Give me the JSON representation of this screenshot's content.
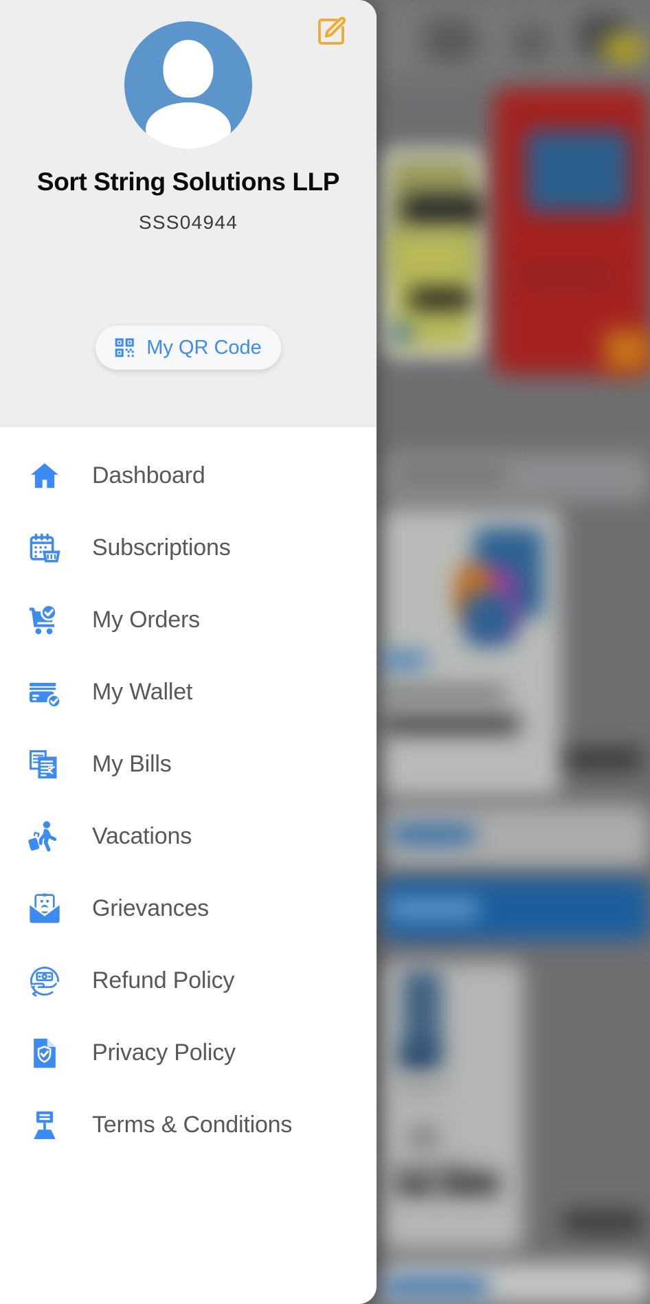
{
  "theme": {
    "accent_blue": "#3d8bf2",
    "icon_blue": "#3d8bf2",
    "edit_icon_orange": "#eeab2d",
    "avatar_blue": "#5b95cc",
    "header_bg": "#eeeeee",
    "drawer_bg": "#ffffff",
    "menu_text": "#58585a"
  },
  "drawer": {
    "header": {
      "edit_icon": "edit-pencil-icon",
      "avatar_icon": "user-avatar-icon",
      "profile_name": "Sort String Solutions LLP",
      "profile_code": "SSS04944",
      "qr_button": {
        "icon": "qr-code-icon",
        "label": "My QR Code"
      }
    },
    "menu": {
      "items": [
        {
          "label": "Dashboard",
          "icon": "home-icon"
        },
        {
          "label": "Subscriptions",
          "icon": "calendar-basket-icon"
        },
        {
          "label": "My Orders",
          "icon": "cart-check-icon"
        },
        {
          "label": "My Wallet",
          "icon": "card-check-icon"
        },
        {
          "label": "My Bills",
          "icon": "invoice-rupee-icon"
        },
        {
          "label": "Vacations",
          "icon": "traveler-luggage-icon"
        },
        {
          "label": "Grievances",
          "icon": "envelope-sad-icon"
        },
        {
          "label": "Refund Policy",
          "icon": "hand-money-refund-icon"
        },
        {
          "label": "Privacy Policy",
          "icon": "document-shield-icon"
        },
        {
          "label": "Terms & Conditions",
          "icon": "document-sign-icon"
        }
      ]
    }
  },
  "background": {
    "description": "blurred app screen behind the drawer overlay",
    "visible_hints": [
      "top app bar with three icons and a yellow badge",
      "red promo card on the right",
      "product cards with prices",
      "light gray Buy Once style button",
      "blue Subscribe style button"
    ]
  }
}
